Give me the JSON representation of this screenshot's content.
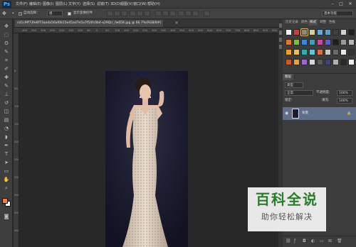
{
  "app": {
    "logo": "Ps"
  },
  "menu": [
    "文件(F)",
    "编辑(E)",
    "图像(I)",
    "图层(L)",
    "文字(Y)",
    "选择(S)",
    "滤镜(T)",
    "3D(D)",
    "视图(V)",
    "窗口(W)",
    "帮助(H)"
  ],
  "window_controls": {
    "minimize": "–",
    "maximize": "□",
    "close": "✕"
  },
  "options_bar": {
    "auto_select_label": "自动选择：",
    "auto_select_value": "组",
    "show_transform_label": "显示变换控件",
    "workspace": "基本功能"
  },
  "document": {
    "tab_title": "cd1c9ff73fe8f73aada56af0b15e45ad7e5a7f54fc0b4-x29Qrr_fw658.jpg @ 66.7%(RGB/8#)",
    "close": "×"
  },
  "ruler_h": [
    "400",
    "350",
    "300",
    "250",
    "200",
    "150",
    "100",
    "50",
    "0",
    "50",
    "100",
    "150",
    "200",
    "250",
    "300",
    "350",
    "400",
    "450",
    "500",
    "550",
    "600",
    "650",
    "700",
    "750",
    "800",
    "850",
    "900",
    "950"
  ],
  "ruler_v": [
    "0",
    "50",
    "100",
    "150",
    "200",
    "250",
    "300",
    "350",
    "400",
    "450",
    "500"
  ],
  "swatch_panel": {
    "tabs": [
      "历史记录",
      "颜色",
      "样式",
      "调整",
      "色板"
    ]
  },
  "swatches": [
    [
      "#f2f2f2",
      "#d23c3c",
      "#8a8a8a",
      "#d6cf95",
      "#6aa8d6",
      "#5aa2c8",
      "#404040",
      "#d0d0d0",
      "#202020"
    ],
    [
      "#e07a2a",
      "#7cbf3a",
      "#3a86d8",
      "#3aa0c8",
      "#c84a9a",
      "#5e5ed0",
      "#1e1e1e",
      "#9a9a9a",
      "#b8b8b8"
    ],
    [
      "#f0a020",
      "#e8c048",
      "#2ab0a8",
      "#58c8e0",
      "#d87040",
      "#c8c8c8",
      "#6a6a6a",
      "#e8e8e8",
      "#343434"
    ],
    [
      "#c85a28",
      "#e8a040",
      "#9a6ad0",
      "#d8d8d8",
      "#5a5a5a",
      "#404080",
      "#b0b0b0",
      "#2a2a2a",
      "#efefef"
    ]
  ],
  "layers_panel": {
    "tab": "图层",
    "kind_label": "类型",
    "blend_mode": "正常",
    "opacity_label": "不透明度:",
    "opacity_value": "100%",
    "lock_label": "锁定:",
    "fill_label": "填充:",
    "fill_value": "100%",
    "layers": [
      {
        "name": "背景"
      }
    ]
  },
  "watermark": {
    "logo": "百科全说",
    "subtitle": "助你轻松解决"
  },
  "colors": {
    "foreground": "#f0813a",
    "background": "#ffffff",
    "selected_layer": "#5f6f89",
    "watermark_green": "#2a7d2a"
  }
}
